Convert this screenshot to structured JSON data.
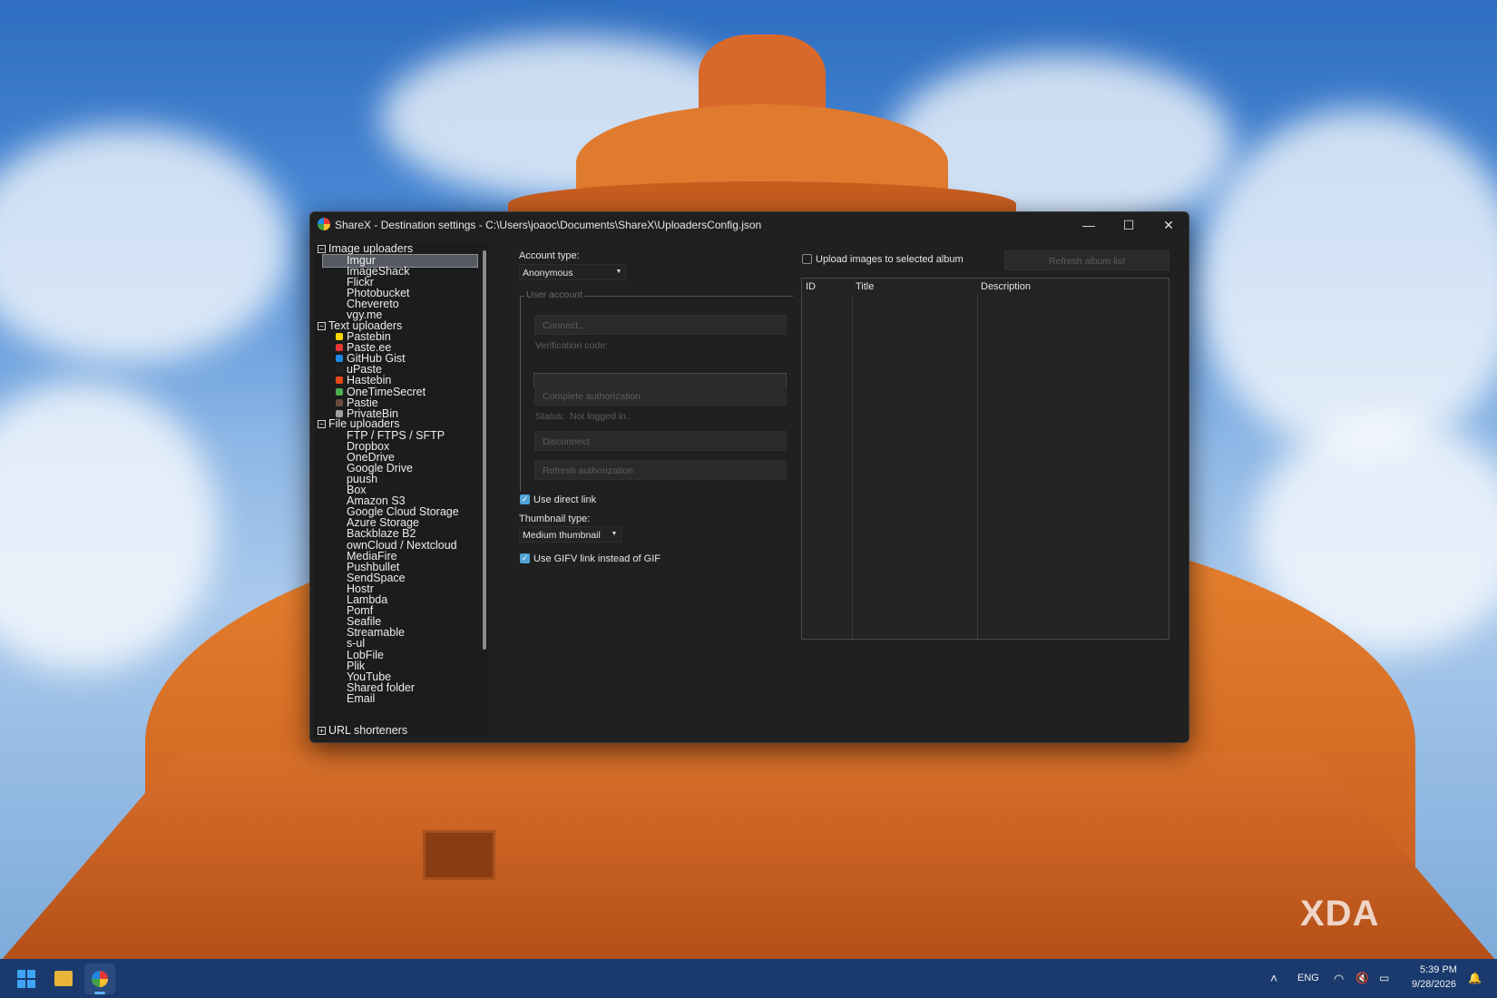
{
  "window": {
    "title": "ShareX - Destination settings - C:\\Users\\joaoc\\Documents\\ShareX\\UploadersConfig.json",
    "minimize_label": "—",
    "maximize_label": "☐",
    "close_label": "✕"
  },
  "tree": {
    "groups": [
      {
        "label": "Image uploaders",
        "toggle": "−"
      },
      {
        "label": "Text uploaders",
        "toggle": "−"
      },
      {
        "label": "File uploaders",
        "toggle": "−"
      },
      {
        "label": "URL shorteners",
        "toggle": "+"
      }
    ],
    "image_items": [
      "Imgur",
      "ImageShack",
      "Flickr",
      "Photobucket",
      "Chevereto",
      "vgy.me"
    ],
    "text_items": [
      "Pastebin",
      "Paste.ee",
      "GitHub Gist",
      "uPaste",
      "Hastebin",
      "OneTimeSecret",
      "Pastie",
      "PrivateBin"
    ],
    "file_items": [
      "FTP / FTPS / SFTP",
      "Dropbox",
      "OneDrive",
      "Google Drive",
      "puush",
      "Box",
      "Amazon S3",
      "Google Cloud Storage",
      "Azure Storage",
      "Backblaze B2",
      "ownCloud / Nextcloud",
      "MediaFire",
      "Pushbullet",
      "SendSpace",
      "Hostr",
      "Lambda",
      "Pomf",
      "Seafile",
      "Streamable",
      "s-ul",
      "LobFile",
      "Plik",
      "YouTube",
      "Shared folder",
      "Email"
    ],
    "selected": "Imgur"
  },
  "settings": {
    "account_type_label": "Account type:",
    "account_type_value": "Anonymous",
    "user_account_group": "User account",
    "connect_label": "Connect...",
    "verification_label": "Verification code:",
    "complete_auth_label": "Complete authorization",
    "status_label": "Status:",
    "status_value": "Not logged in.",
    "disconnect_label": "Disconnect",
    "refresh_auth_label": "Refresh authorization",
    "use_direct_link_label": "Use direct link",
    "use_direct_link_checked": true,
    "thumbnail_type_label": "Thumbnail type:",
    "thumbnail_type_value": "Medium thumbnail",
    "use_gifv_label": "Use GIFV link instead of GIF",
    "use_gifv_checked": true,
    "upload_to_album_label": "Upload images to selected album",
    "upload_to_album_checked": false,
    "refresh_album_label": "Refresh album list"
  },
  "album_list": {
    "columns": [
      "ID",
      "Title",
      "Description"
    ],
    "rows": []
  },
  "taskbar": {
    "language": "ENG",
    "time": "5:39 PM",
    "date": "9/28/2026"
  },
  "watermark": "XDA",
  "colors": {
    "accent": "#4fa3d6",
    "window_bg": "#202020",
    "taskbar_bg": "#1a3a6e"
  }
}
